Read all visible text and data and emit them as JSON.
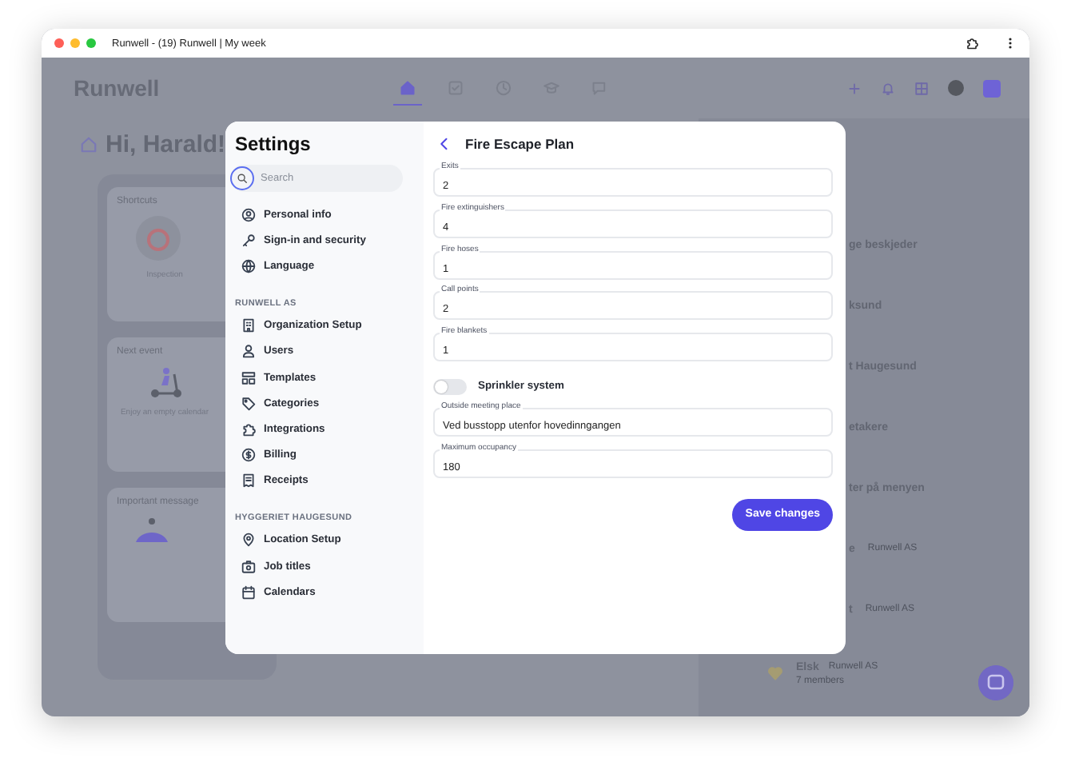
{
  "browser": {
    "title": "Runwell - (19) Runwell | My week"
  },
  "app": {
    "logo": "Runwell",
    "nav": [
      {
        "selected": true
      },
      {
        "selected": false
      },
      {
        "selected": false
      },
      {
        "selected": false
      },
      {
        "selected": false
      }
    ],
    "greeting": "Hi, Harald!",
    "cards": [
      {
        "title": "Shortcuts",
        "label": "Inspection"
      },
      {
        "title": "Next event",
        "label": "Enjoy an empty calendar"
      },
      {
        "title": "Important message"
      }
    ],
    "list": [
      {
        "title": "ge beskjeder"
      },
      {
        "title": "ksund"
      },
      {
        "title": "t Haugesund"
      },
      {
        "title": "etakere"
      },
      {
        "title": "ter på menyen"
      },
      {
        "title": "e",
        "sub": "Runwell AS"
      },
      {
        "title": "t",
        "sub": "Runwell AS"
      },
      {
        "title": "Elsk",
        "sub": "Runwell AS",
        "members": "7 members"
      }
    ]
  },
  "settings": {
    "title": "Settings",
    "search": {
      "placeholder": "Search"
    },
    "sections": [
      {
        "items": [
          {
            "label": "Personal info"
          },
          {
            "label": "Sign-in and security"
          },
          {
            "label": "Language"
          }
        ]
      },
      {
        "heading": "RUNWELL AS",
        "items": [
          {
            "label": "Organization Setup"
          },
          {
            "label": "Users"
          },
          {
            "label": "Templates"
          },
          {
            "label": "Categories"
          },
          {
            "label": "Integrations"
          },
          {
            "label": "Billing"
          },
          {
            "label": "Receipts"
          }
        ]
      },
      {
        "heading": "HYGGERIET HAUGESUND",
        "items": [
          {
            "label": "Location Setup"
          },
          {
            "label": "Job titles"
          },
          {
            "label": "Calendars"
          }
        ]
      }
    ]
  },
  "panel": {
    "title": "Fire Escape Plan",
    "fields": [
      {
        "kind": "field",
        "label": "Exits",
        "value": "2"
      },
      {
        "kind": "field",
        "label": "Fire extinguishers",
        "value": "4"
      },
      {
        "kind": "field",
        "label": "Fire hoses",
        "value": "1"
      },
      {
        "kind": "field",
        "label": "Call points",
        "value": "2"
      },
      {
        "kind": "field",
        "label": "Fire blankets",
        "value": "1"
      },
      {
        "kind": "toggle",
        "label": "Sprinkler system",
        "on": false
      },
      {
        "kind": "field",
        "label": "Outside meeting place",
        "value": "Ved busstopp utenfor hovedinngangen"
      },
      {
        "kind": "field",
        "label": "Maximum occupancy",
        "value": "180"
      }
    ],
    "save": "Save changes"
  }
}
